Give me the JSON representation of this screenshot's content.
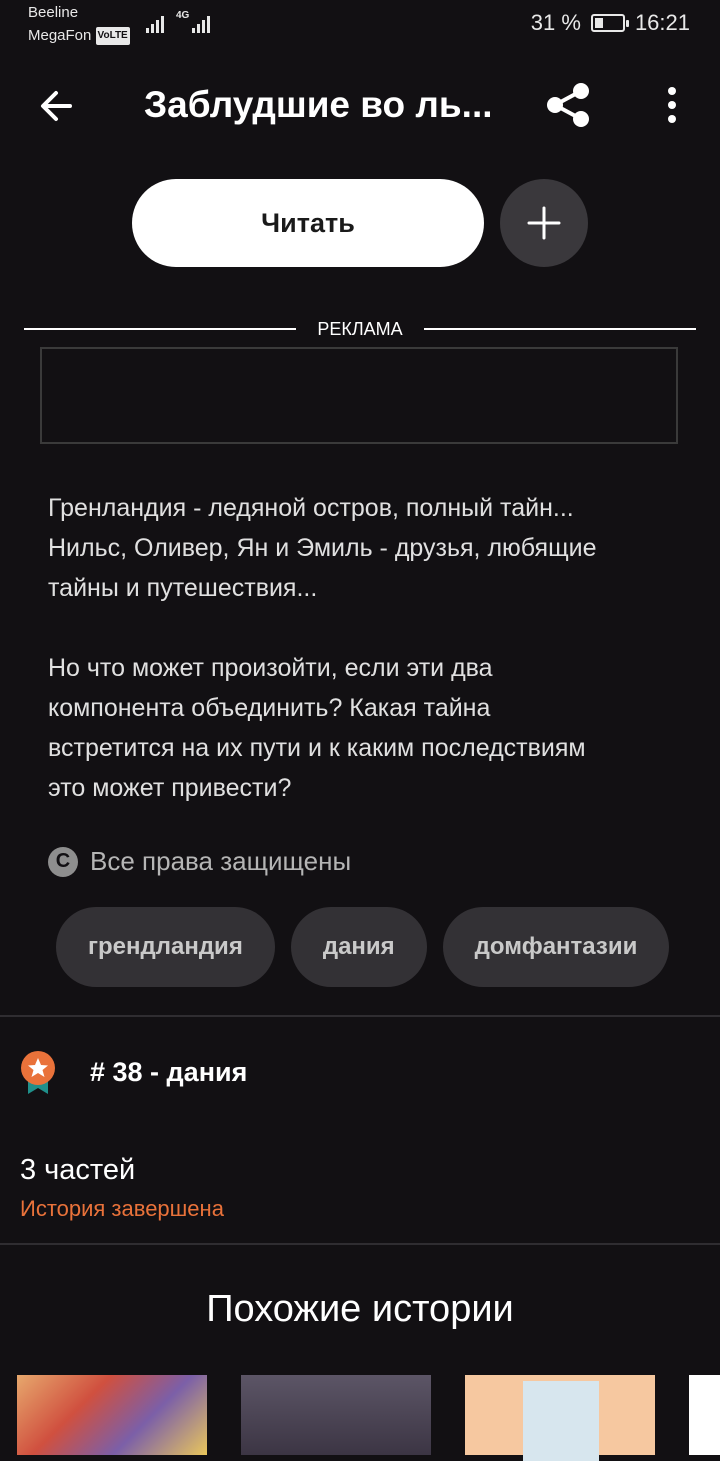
{
  "status_bar": {
    "carrier1": "Beeline",
    "carrier2": "MegaFon",
    "volte": "VoLTE",
    "network": "4G",
    "battery": "31 %",
    "battery_level": 0.31,
    "time": "16:21"
  },
  "header": {
    "title": "Заблудшие во ль..."
  },
  "actions": {
    "read_label": "Читать"
  },
  "ad": {
    "label": "РЕКЛАМА"
  },
  "description": "Гренландия - ледяной остров, полный тайн...\nНильс, Оливер, Ян и Эмиль - друзья, любящие\nтайны и путешествия...\n\nНо что может произойти, если эти два\nкомпонента объединить? Какая тайна\nвстретится на их пути и к каким последствиям\nэто может привести?",
  "rights": "Все права защищены",
  "tags": [
    "грендландия",
    "дания",
    "домфантазии"
  ],
  "ranking": {
    "text": "# 38 - дания"
  },
  "parts": {
    "count_label": "3 частей",
    "status": "История завершена"
  },
  "similar": {
    "title": "Похожие истории"
  },
  "colors": {
    "accent": "#e9723a",
    "background": "#121013"
  }
}
